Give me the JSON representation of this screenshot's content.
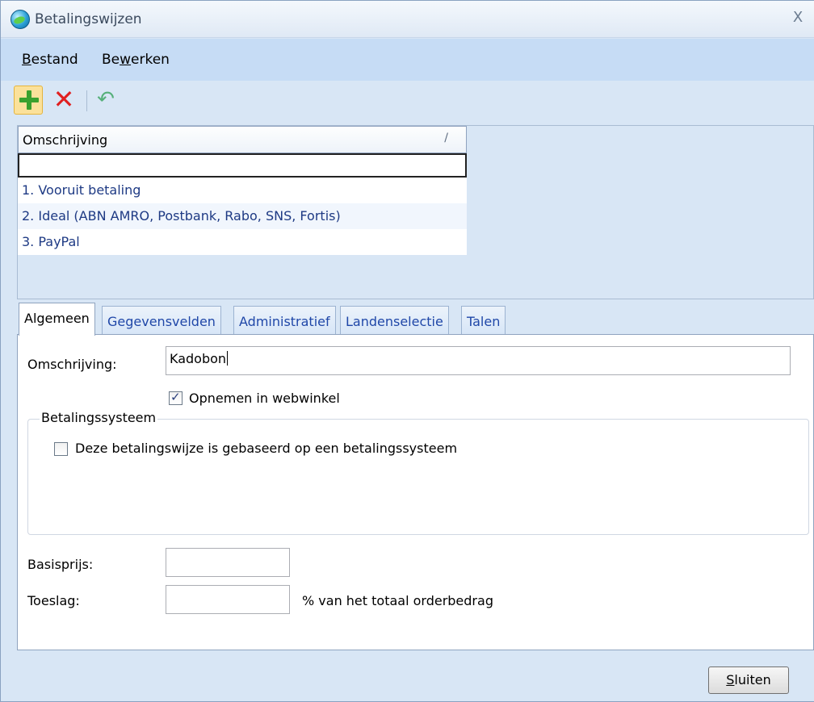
{
  "window": {
    "title": "Betalingswijzen",
    "close_symbol": "X"
  },
  "menu": {
    "items": [
      {
        "label_pre": "",
        "label_key": "B",
        "label_post": "estand"
      },
      {
        "label_pre": "Be",
        "label_key": "w",
        "label_post": "erken"
      }
    ]
  },
  "toolbar": {
    "icons": [
      "add-icon",
      "delete-icon",
      "undo-icon"
    ]
  },
  "grid": {
    "column_header": "Omschrijving",
    "sort_indicator": "/",
    "filter_value": "",
    "rows": [
      "1. Vooruit betaling",
      "2. Ideal (ABN AMRO, Postbank, Rabo, SNS, Fortis)",
      "3. PayPal"
    ]
  },
  "tabs": [
    {
      "label": "Algemeen",
      "active": true
    },
    {
      "label": "Gegevensvelden",
      "active": false
    },
    {
      "label": "Administratief",
      "active": false
    },
    {
      "label": "Landenselectie",
      "active": false
    },
    {
      "label": "Talen",
      "active": false
    }
  ],
  "form": {
    "omschrijving_label": "Omschrijving:",
    "omschrijving_value": "Kadobon",
    "webwinkel_label": "Opnemen in webwinkel",
    "webwinkel_checked": true,
    "betalingssysteem_group_title": "Betalingssysteem",
    "betalingssysteem_label": "Deze betalingswijze is gebaseerd op een betalingssysteem",
    "betalingssysteem_checked": false,
    "basisprijs_label": "Basisprijs:",
    "basisprijs_value": "",
    "toeslag_label": "Toeslag:",
    "toeslag_value": "",
    "toeslag_suffix": "% van het totaal orderbedrag"
  },
  "footer": {
    "close_key": "S",
    "close_rest": "luiten"
  },
  "colors": {
    "accent": "#c6dcf5",
    "link_text": "#1e3a84",
    "tab_text": "#1f47a8"
  }
}
